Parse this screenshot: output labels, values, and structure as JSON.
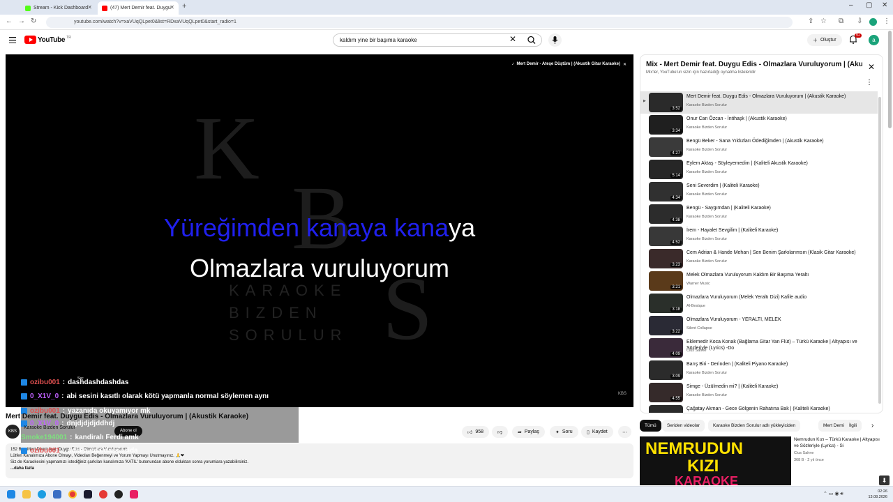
{
  "browser": {
    "tabs": [
      {
        "title": "Stream - Kick Dashboard",
        "active": false
      },
      {
        "title": "(47) Mert Demir feat. Duygu",
        "active": true
      }
    ],
    "url": "youtube.com/watch?v=xaVUqQLpet0&list=RDxaVUqQLpet0&start_radio=1"
  },
  "youtube": {
    "logo_text": "YouTube",
    "logo_country": "TR",
    "search_value": "kaldım yine bir başıma karaoke",
    "create_label": "Oluştur",
    "notifications_count": "9+",
    "avatar_letter": "a"
  },
  "player": {
    "watermark_letters": [
      "K",
      "B",
      "S"
    ],
    "watermark_lines": [
      "KARAOKE",
      "BIZDEN",
      "SORULUR"
    ],
    "lyric_line1_sung": "Yüreğimden kanaya kana",
    "lyric_line1_rest": "ya",
    "lyric_line2": "Olmazlara vuruluyorum",
    "overlay_title": "Mert Demir - Ateşe Düştüm | (Akustik Gitar Karaoke)",
    "corner_mark": "KBS",
    "chat_tooltip": "Seç",
    "chat": [
      {
        "user": "ozibu001",
        "color": "#e05050",
        "text": "dashdashdashdas"
      },
      {
        "user": "0_X1V_0",
        "color": "#c060ff",
        "text": "abi sesini kasıtlı olarak kötü yapmanla normal söylemen aynı"
      },
      {
        "user": "ozibu001",
        "color": "#e05050",
        "text": "yazanıda okuyamıyor mk"
      },
      {
        "user": "0_X1V_0",
        "color": "#c060ff",
        "text": "dnjdjdjdjddhdj"
      },
      {
        "user": "Smoke194001",
        "color": "#7ee07e",
        "text": "kandiralı Ferdi amk"
      },
      {
        "user": "ozibu001",
        "color": "#e05050",
        "text": "adlasusdaidasdasida"
      }
    ]
  },
  "video": {
    "title": "Mert Demir feat. Duygu Edis - Olmazlara Vuruluyorum | (Akustik Karaoke)",
    "channel": "Karaoke Bizden Sorulur",
    "channel_avatar": "KBS",
    "subscribe_label": "Abone ol",
    "likes": "958",
    "share_label": "Paylaş",
    "ask_label": "Soru",
    "save_label": "Kaydet",
    "desc_line1": "152 B ... Mert Demir feat. Duygu Edis - Olmazlara Vuruluyorum",
    "desc_line2": "Lütfen Kanalımıza Abone Olmayı, Videoları Beğenmeyi ve Yorum Yapmayı Unutmayınız. 🙏❤",
    "desc_line3": "Siz de Karaokesini yapmamızı istediğiniz şarkıları kanalımıza 'KATIL' butonundan abone olduktan sonra yorumlara yazabilirsiniz.",
    "desc_more": "...daha fazla"
  },
  "playlist": {
    "title": "Mix - Mert Demir feat. Duygu Edis - Olmazlara Vuruluyorum | (Akustik Karaoke)",
    "subtitle": "Mix'ler, YouTube'un sizin için hazırladığı oynatma listeleridir",
    "items": [
      {
        "title": "Mert Demir feat. Duygu Edis - Olmazlara Vuruluyorum | (Akustik Karaoke)",
        "channel": "Karaoke Bizden Sorulur",
        "duration": "3:52",
        "active": true
      },
      {
        "title": "Onur Can Özcan - İntihaşk | (Akustik Karaoke)",
        "channel": "Karaoke Bizden Sorulur",
        "duration": "3:34"
      },
      {
        "title": "Bengü Beker - Sana Yıldızları Ödediğimden | (Akustik Karaoke)",
        "channel": "Karaoke Bizden Sorulur",
        "duration": "4:27"
      },
      {
        "title": "Eylem Aktaş - Söyleyemedim | (Kaliteli Akustik Karaoke)",
        "channel": "Karaoke Bizden Sorulur",
        "duration": "5:14"
      },
      {
        "title": "Seni Severdim | (Kaliteli Karaoke)",
        "channel": "Karaoke Bizden Sorulur",
        "duration": "4:34"
      },
      {
        "title": "Bengü - Saygımdan | (Kaliteli Karaoke)",
        "channel": "Karaoke Bizden Sorulur",
        "duration": "4:38"
      },
      {
        "title": "İrem - Hayalet Sevgilim | (Kaliteli Karaoke)",
        "channel": "Karaoke Bizden Sorulur",
        "duration": "4:52"
      },
      {
        "title": "Cem Adrian & Hande Mehan | Sen Benim Şarkılarımsın (Klasik Gitar Karaoke)",
        "channel": "Karaoke Bizden Sorulur",
        "duration": "3:23"
      },
      {
        "title": "Melek Olmazlara Vuruluyorum Kaldım Bir Başıma Yeraltı",
        "channel": "Warner Music",
        "duration": "3:21"
      },
      {
        "title": "Olmazlara Vuruluyorum (Melek Yeraltı Dizi) Kafile audio",
        "channel": "Al-Bestque",
        "duration": "3:18"
      },
      {
        "title": "Olmazlara Vuruluyorum - YERALTI, MELEK",
        "channel": "Silent Collapse",
        "duration": "3:22"
      },
      {
        "title": "Eklemedir Koca Konak (Bağlama Gitar Yan Flüt) – Türkü Karaoke | Altyapısı ve Sözleriyle (Lyrics) -Do",
        "channel": "Cius Sahne",
        "duration": "4:09"
      },
      {
        "title": "Barış Biri - Derinden | (Kaliteli Piyano Karaoke)",
        "channel": "Karaoke Bizden Sorulur",
        "duration": "3:09"
      },
      {
        "title": "Simge - Üzülmedin mi? | (Kaliteli Karaoke)",
        "channel": "Karaoke Bizden Sorulur",
        "duration": "4:55"
      },
      {
        "title": "Çağatay Akman - Gece Gölgenin Rahatına Bak | (Kaliteli Karaoke)",
        "channel": "Karaoke Bizden Sorulur",
        "duration": ""
      }
    ]
  },
  "chips": [
    "Tümü",
    "Seriden videolar",
    "Karaoke Bizden Sorulur adlı yükleyiciden",
    "Mert Demir",
    "İlgili"
  ],
  "recommendation": {
    "thumb_lines": [
      "NEMRUDUN",
      "KIZI",
      "KARAOKE"
    ],
    "title": "Nemrudun Kızı – Türkü Karaoke | Altyapısı ve Sözleriyle (Lyrics) - Si",
    "channel": "Cius Sahne",
    "meta": "368 B · 2 yıl önce"
  },
  "taskbar": {
    "time": "02:26",
    "date": "13.08.2026"
  }
}
